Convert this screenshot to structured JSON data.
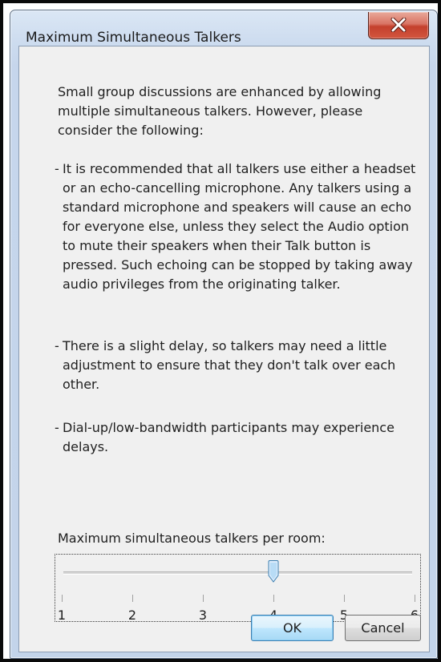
{
  "window": {
    "title": "Maximum Simultaneous Talkers",
    "close_icon": "close-x-icon"
  },
  "intro": "Small group discussions are enhanced by allowing multiple simultaneous talkers.  However, please consider the following:",
  "bullets": [
    "It is recommended that all talkers use either a headset or an echo-cancelling microphone.  Any talkers using a standard microphone and speakers will cause an echo for everyone else, unless they select the Audio option to mute their speakers when their Talk button is pressed.  Such echoing can be stopped by taking away audio privileges from the originating talker.",
    "There is a slight delay, so talkers may need a little adjustment to ensure that they don't talk over each other.",
    "Dial-up/low-bandwidth participants may experience delays."
  ],
  "bullet_marker": "-",
  "slider": {
    "label": "Maximum simultaneous talkers per room:",
    "min": 1,
    "max": 6,
    "value": 4,
    "ticks": [
      "1",
      "2",
      "3",
      "4",
      "5",
      "6"
    ]
  },
  "buttons": {
    "ok": "OK",
    "cancel": "Cancel"
  }
}
